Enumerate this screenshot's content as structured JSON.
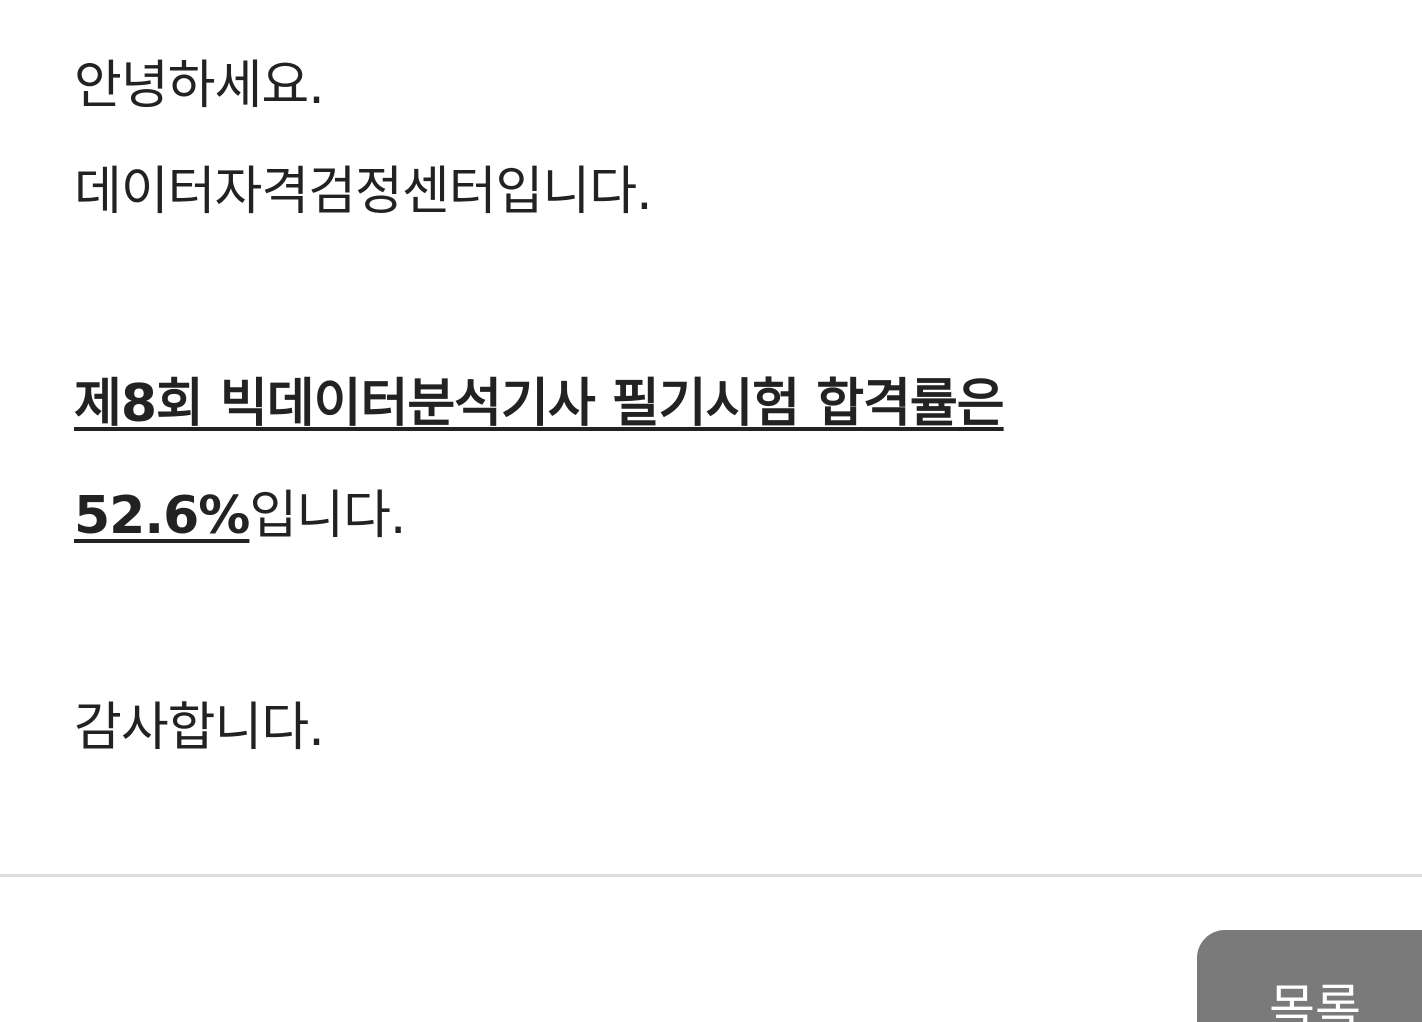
{
  "article": {
    "greeting": "안녕하세요.",
    "intro": "데이터자격검정센터입니다.",
    "highlight_line1": "제8회 빅데이터분석기사 필기시험 합격률은",
    "pass_rate": "52.6%",
    "highlight_suffix": "입니다.",
    "closing": "감사합니다."
  },
  "footer": {
    "list_button_label": "목록"
  },
  "colors": {
    "text": "#222222",
    "divider": "#dddddd",
    "button_bg": "#7a7a7a",
    "button_text": "#ffffff"
  }
}
